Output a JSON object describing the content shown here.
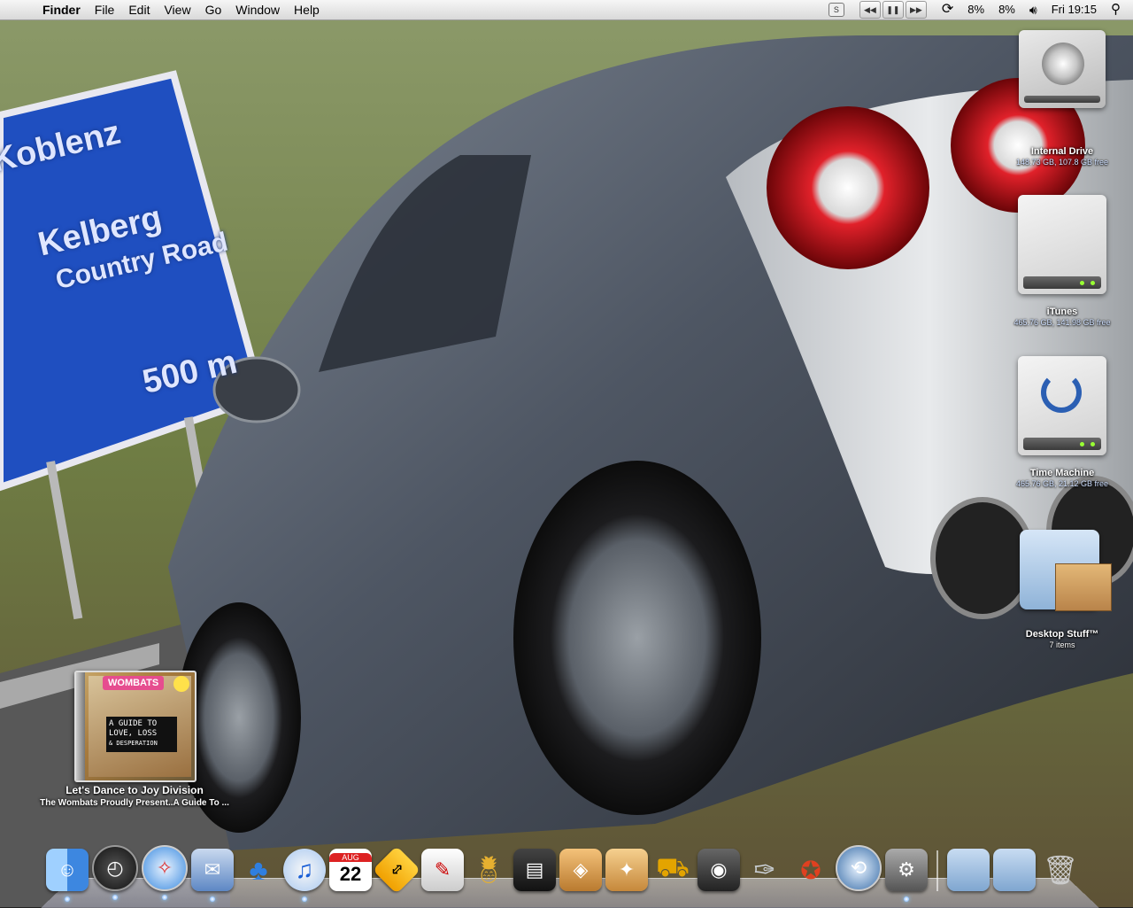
{
  "menubar": {
    "apple_icon": "apple-icon",
    "app_name": "Finder",
    "menus": [
      "File",
      "Edit",
      "View",
      "Go",
      "Window",
      "Help"
    ],
    "status": {
      "cpu1": "8%",
      "cpu2": "8%",
      "clock": "Fri 19:15"
    }
  },
  "desktop_icons": [
    {
      "name": "Internal Drive",
      "info": "148.73 GB, 107.8 GB free"
    },
    {
      "name": "iTunes",
      "info": "465.76 GB, 141.98 GB free"
    },
    {
      "name": "Time Machine",
      "info": "465.76 GB, 21.12 GB free"
    },
    {
      "name": "Desktop Stuff™",
      "info": "7 items"
    }
  ],
  "album_widget": {
    "band": "WOMBATS",
    "cover_lines": [
      "A GUIDE TO",
      "LOVE, LOSS",
      "& DESPERATION"
    ],
    "track": "Let's Dance to Joy Division",
    "album": "The Wombats Proudly Present..A Guide To ..."
  },
  "dock": {
    "calendar_month": "AUG",
    "calendar_day": "22"
  },
  "wallpaper": {
    "sign_lines": [
      "Koblenz",
      "Kelberg",
      "Country Road",
      "500 m"
    ],
    "sign_color": "#1f4fc0"
  }
}
